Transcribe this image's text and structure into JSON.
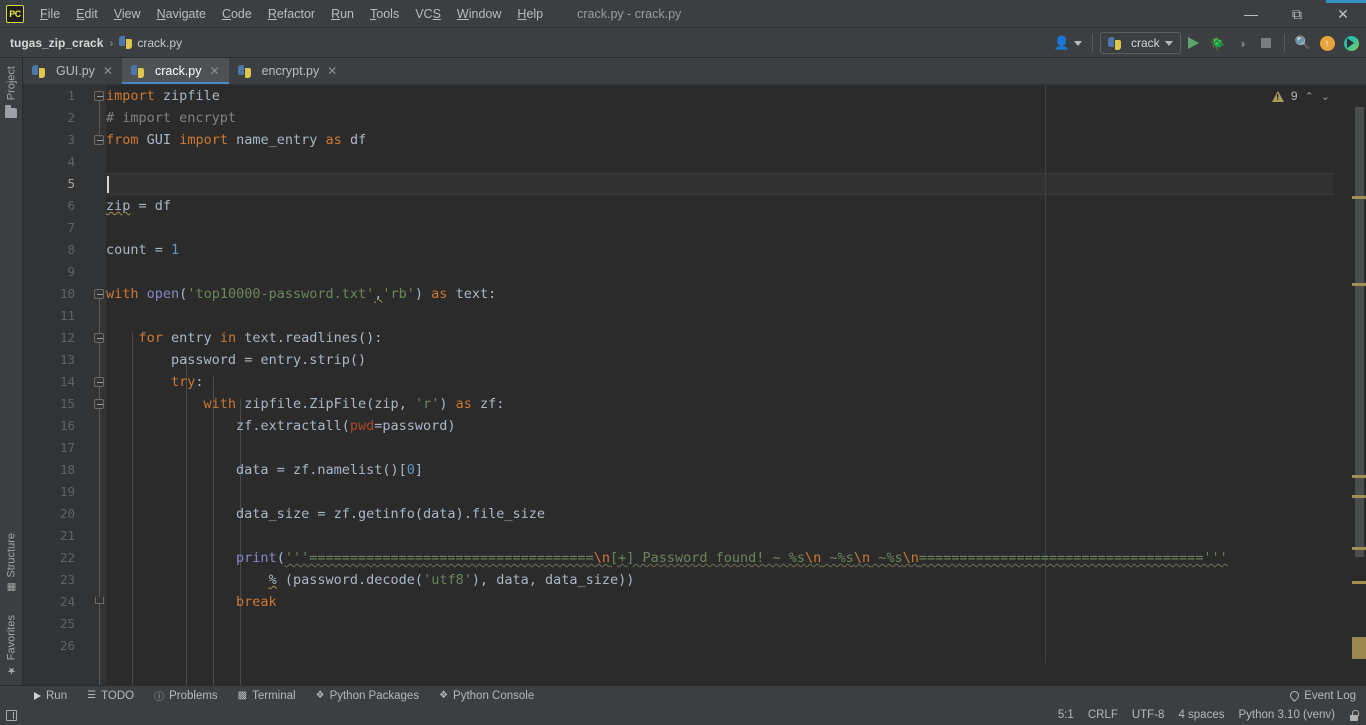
{
  "window": {
    "app_logo": "pycharm-logo",
    "title": "crack.py - crack.py",
    "minimize": "—",
    "maximize": "❐",
    "close": "✕"
  },
  "menu": {
    "items": [
      {
        "label": "File"
      },
      {
        "label": "Edit"
      },
      {
        "label": "View"
      },
      {
        "label": "Navigate"
      },
      {
        "label": "Code"
      },
      {
        "label": "Refactor"
      },
      {
        "label": "Run"
      },
      {
        "label": "Tools"
      },
      {
        "label": "VCS"
      },
      {
        "label": "Window"
      },
      {
        "label": "Help"
      }
    ]
  },
  "breadcrumb": {
    "project": "tugas_zip_crack",
    "separator": "›",
    "file": "crack.py"
  },
  "toolbar": {
    "account_icon": "👤",
    "account_caret": "▾",
    "run_config_label": "crack",
    "run_icon": "run-icon",
    "debug_icon": "🐞",
    "coverage_icon": "◑",
    "stop_icon": "stop-icon",
    "search_icon": "🔍",
    "update_icon": "↑",
    "ide_icon": "ide-icon"
  },
  "tool_strip": {
    "project": "Project",
    "structure": "Structure",
    "favorites": "Favorites"
  },
  "tabs": [
    {
      "label": "GUI.py",
      "close": "✕",
      "active": false
    },
    {
      "label": "crack.py",
      "close": "✕",
      "active": true
    },
    {
      "label": "encrypt.py",
      "close": "✕",
      "active": false
    }
  ],
  "inspection": {
    "warning_count": "9",
    "prev": "⌃",
    "next": "⌄"
  },
  "editor": {
    "line_count": 26,
    "current_line": 5,
    "lines": [
      {
        "n": 1,
        "text": "import zipfile"
      },
      {
        "n": 2,
        "text": "# import encrypt"
      },
      {
        "n": 3,
        "text": "from GUI import name_entry as df"
      },
      {
        "n": 4,
        "text": ""
      },
      {
        "n": 5,
        "text": ""
      },
      {
        "n": 6,
        "text": "zip = df"
      },
      {
        "n": 7,
        "text": ""
      },
      {
        "n": 8,
        "text": "count = 1"
      },
      {
        "n": 9,
        "text": ""
      },
      {
        "n": 10,
        "text": "with open('top10000-password.txt','rb') as text:"
      },
      {
        "n": 11,
        "text": ""
      },
      {
        "n": 12,
        "text": "    for entry in text.readlines():"
      },
      {
        "n": 13,
        "text": "        password = entry.strip()"
      },
      {
        "n": 14,
        "text": "        try:"
      },
      {
        "n": 15,
        "text": "            with zipfile.ZipFile(zip, 'r') as zf:"
      },
      {
        "n": 16,
        "text": "                zf.extractall(pwd=password)"
      },
      {
        "n": 17,
        "text": ""
      },
      {
        "n": 18,
        "text": "                data = zf.namelist()[0]"
      },
      {
        "n": 19,
        "text": ""
      },
      {
        "n": 20,
        "text": "                data_size = zf.getinfo(data).file_size"
      },
      {
        "n": 21,
        "text": ""
      },
      {
        "n": 22,
        "text": "                print('''===================================\\n[+] Password found! ~ %s\\n ~%s\\n ~%s\\n==================================='''"
      },
      {
        "n": 23,
        "text": "                    % (password.decode('utf8'), data, data_size))"
      },
      {
        "n": 24,
        "text": "                break"
      },
      {
        "n": 25,
        "text": ""
      },
      {
        "n": 26,
        "text": ""
      }
    ]
  },
  "bottom_bar": {
    "items": [
      {
        "label": "Run",
        "icon": "run-icon"
      },
      {
        "label": "TODO",
        "icon": "list-icon"
      },
      {
        "label": "Problems",
        "icon": "info-icon"
      },
      {
        "label": "Terminal",
        "icon": "terminal-icon"
      },
      {
        "label": "Python Packages",
        "icon": "packages-icon"
      },
      {
        "label": "Python Console",
        "icon": "python-icon"
      }
    ],
    "event_log": "Event Log"
  },
  "status_bar": {
    "caret_position": "5:1",
    "line_separator": "CRLF",
    "encoding": "UTF-8",
    "indent": "4 spaces",
    "interpreter": "Python 3.10 (venv)",
    "lock_icon": "lock-icon"
  },
  "colors": {
    "accent_blue": "#4a88c7",
    "bg_chrome": "#3c3f41",
    "bg_editor": "#2b2b2b",
    "bg_gutter": "#313335",
    "keyword": "#cc7832",
    "string": "#6a8759",
    "number": "#6897bb",
    "comment": "#808080",
    "function": "#ffc66d",
    "default_text": "#a9b7c6",
    "param": "#aa4926",
    "warning": "#a8a05a",
    "run_green": "#59a869"
  }
}
